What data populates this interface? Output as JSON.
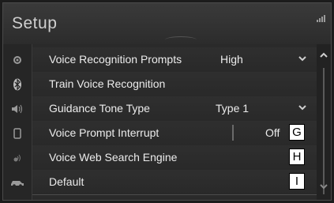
{
  "header": {
    "title": "Setup"
  },
  "rail": {
    "icons": [
      "settings-icon",
      "bluetooth-icon",
      "sound-icon",
      "phone-icon",
      "voice-icon",
      "car-icon"
    ]
  },
  "rows": [
    {
      "label": "Voice Recognition Prompts",
      "value": "High",
      "has_dropdown": true
    },
    {
      "label": "Train Voice Recognition",
      "value": "",
      "has_dropdown": false
    },
    {
      "label": "Guidance Tone Type",
      "value": "Type 1",
      "has_dropdown": true
    },
    {
      "label": "Voice Prompt Interrupt",
      "value": "Off",
      "has_dropdown": false,
      "callout": "G"
    },
    {
      "label": "Voice Web Search Engine",
      "value": "",
      "has_dropdown": false,
      "callout": "H"
    },
    {
      "label": "Default",
      "value": "",
      "has_dropdown": false,
      "callout": "I"
    }
  ],
  "colors": {
    "background": "#2a2a2a",
    "text": "#ececec",
    "divider": "#4c4c4c",
    "callout_bg": "#ffffff"
  }
}
